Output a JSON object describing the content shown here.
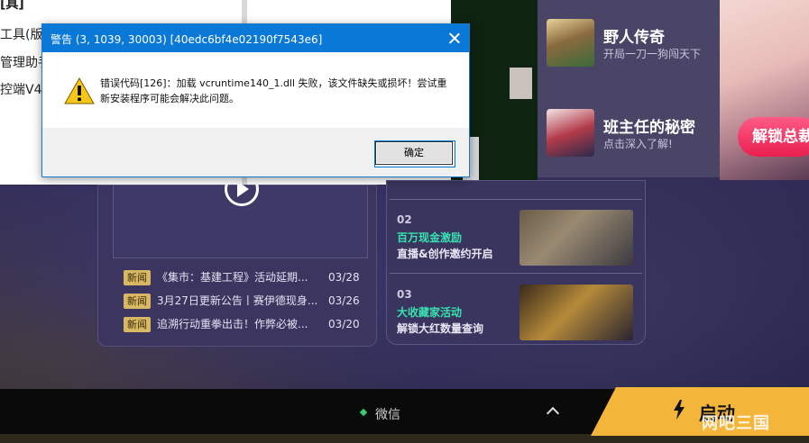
{
  "dialog": {
    "title": "警告 (3, 1039, 30003) [40edc6bf4e02190f7543e6]",
    "message": "错误代码[126]：加载 vcruntime140_1.dll 失败，该文件缺失或损坏！尝试重新安装程序可能会解决此问题。",
    "ok_label": "确定",
    "icon": "warning-icon"
  },
  "background_window": {
    "lines": [
      "[具]",
      "工具(版",
      "管理助手",
      "控端V4"
    ]
  },
  "side_games": [
    {
      "title": "野人传奇",
      "subtitle": "开局一刀一狗闯天下"
    },
    {
      "title": "班主任的秘密",
      "subtitle": "点击深入了解!"
    }
  ],
  "unlock_label": "解锁总裁",
  "news": {
    "items": [
      {
        "tag": "新闻",
        "title": "《集市：基建工程》活动延期...",
        "date": "03/28"
      },
      {
        "tag": "新闻",
        "title": "3月27日更新公告丨赛伊德现身...",
        "date": "03/26"
      },
      {
        "tag": "新闻",
        "title": "追溯行动重拳出击！作弊必被...",
        "date": "03/20"
      }
    ]
  },
  "events": [
    {
      "num": "02",
      "line1": "百万现金激励",
      "line2": "直播&创作邀约开启"
    },
    {
      "num": "03",
      "line1": "大收藏家活动",
      "line2": "解锁大红数量查询"
    }
  ],
  "footer": {
    "wechat_label": "微信",
    "start_label": "启动",
    "watermark": "网吧三国"
  },
  "colors": {
    "dialog_titlebar": "#0a78d7",
    "event_accent": "#37e2b0",
    "start_button": "#f4b63a",
    "unlock_button": "#e8204f"
  }
}
